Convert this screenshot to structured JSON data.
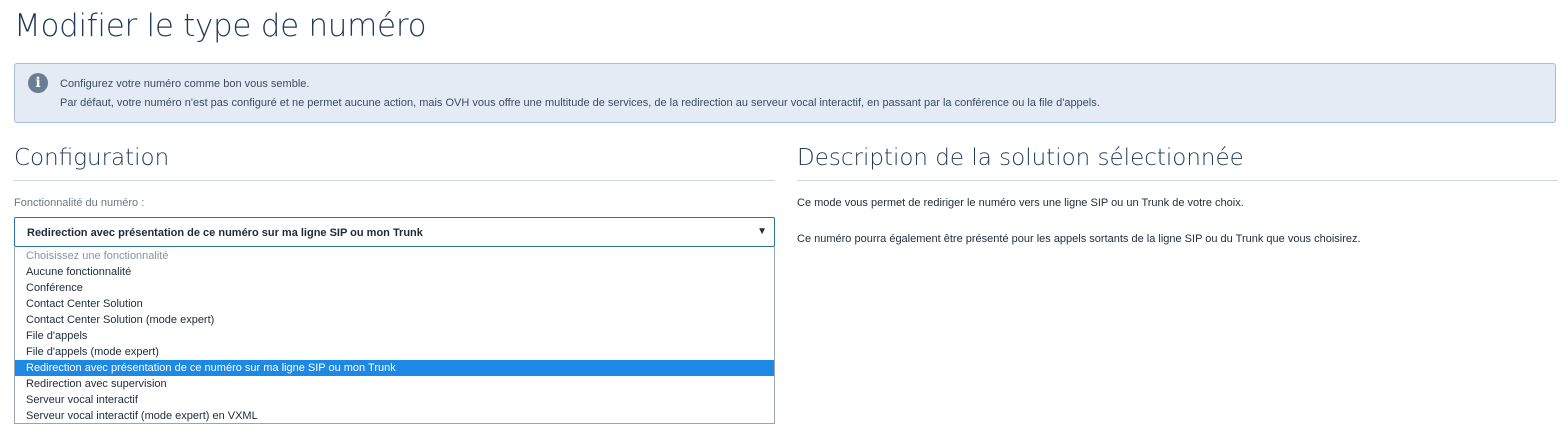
{
  "page": {
    "title": "Modifier le type de numéro"
  },
  "info": {
    "icon": "info-icon",
    "line1": "Configurez votre numéro comme bon vous semble.",
    "line2": "Par défaut, votre numéro n'est pas configuré et ne permet aucune action, mais OVH vous offre une multitude de services, de la redirection au serveur vocal interactif, en passant par la conférence ou la file d'appels."
  },
  "configuration": {
    "title": "Configuration",
    "field_label": "Fonctionnalité du numéro :",
    "selected_value": "Redirection avec présentation de ce numéro sur ma ligne SIP ou mon Trunk",
    "options": [
      "Choisissez une fonctionnalité",
      "Aucune fonctionnalité",
      "Conférence",
      "Contact Center Solution",
      "Contact Center Solution (mode expert)",
      "File d'appels",
      "File d'appels (mode expert)",
      "Redirection avec présentation de ce numéro sur ma ligne SIP ou mon Trunk",
      "Redirection avec supervision",
      "Serveur vocal interactif",
      "Serveur vocal interactif (mode expert) en VXML"
    ]
  },
  "description": {
    "title": "Description de la solution sélectionnée",
    "paragraph1": "Ce mode vous permet de rediriger le numéro vers une ligne SIP ou un Trunk de votre choix.",
    "paragraph2": "Ce numéro pourra également être présenté pour les appels sortants de la ligne SIP ou du Trunk que vous choisirez."
  },
  "colors": {
    "title": "#1e3a57",
    "info_background": "#e4ebf5",
    "selected_option": "#1e88e5",
    "select_border": "#2d6f9f"
  }
}
